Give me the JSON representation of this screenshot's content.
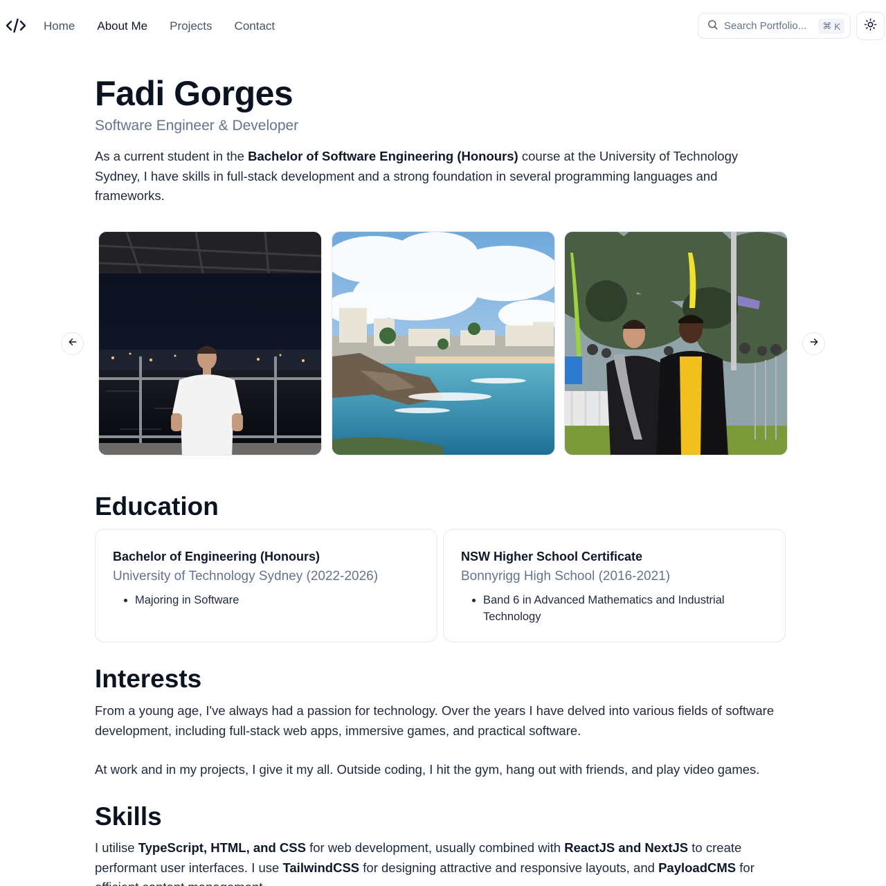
{
  "header": {
    "nav": [
      {
        "label": "Home"
      },
      {
        "label": "About Me"
      },
      {
        "label": "Projects"
      },
      {
        "label": "Contact"
      }
    ],
    "search": {
      "placeholder": "Search Portfolio...",
      "shortcut_symbol": "⌘",
      "shortcut_key": "K"
    }
  },
  "hero": {
    "name": "Fadi Gorges",
    "role": "Software Engineer & Developer",
    "intro_pre": "As a current student in the ",
    "intro_bold": "Bachelor of Software Engineering (Honours)",
    "intro_post": " course at the University of Technology Sydney, I have skills in full-stack development and a strong foundation in several programming languages and frameworks."
  },
  "carousel": {
    "slides": [
      {
        "scene": "night-harbour-portrait"
      },
      {
        "scene": "coastal-beach-view"
      },
      {
        "scene": "festival-friends-photo"
      }
    ]
  },
  "education": {
    "heading": "Education",
    "items": [
      {
        "title": "Bachelor of Engineering (Honours)",
        "institution": "University of Technology Sydney (2022-2026)",
        "points": [
          "Majoring in Software"
        ]
      },
      {
        "title": "NSW Higher School Certificate",
        "institution": "Bonnyrigg High School (2016-2021)",
        "points": [
          "Band 6 in Advanced Mathematics and Industrial Technology"
        ]
      }
    ]
  },
  "interests": {
    "heading": "Interests",
    "p1": "From a young age, I've always had a passion for technology. Over the years I have delved into various fields of software development, including full-stack web apps, immersive games, and practical software.",
    "p2": "At work and in my projects, I give it my all. Outside coding, I hit the gym, hang out with friends, and play video games."
  },
  "skills": {
    "heading": "Skills",
    "s1": "I utilise ",
    "b1": "TypeScript, HTML, and CSS",
    "s2": " for web development, usually combined with ",
    "b2": "ReactJS and NextJS",
    "s3": " to create performant user interfaces. I use ",
    "b3": "TailwindCSS",
    "s4": " for designing attractive and responsive layouts, and ",
    "b4": "PayloadCMS",
    "s5": " for efficient content management."
  }
}
